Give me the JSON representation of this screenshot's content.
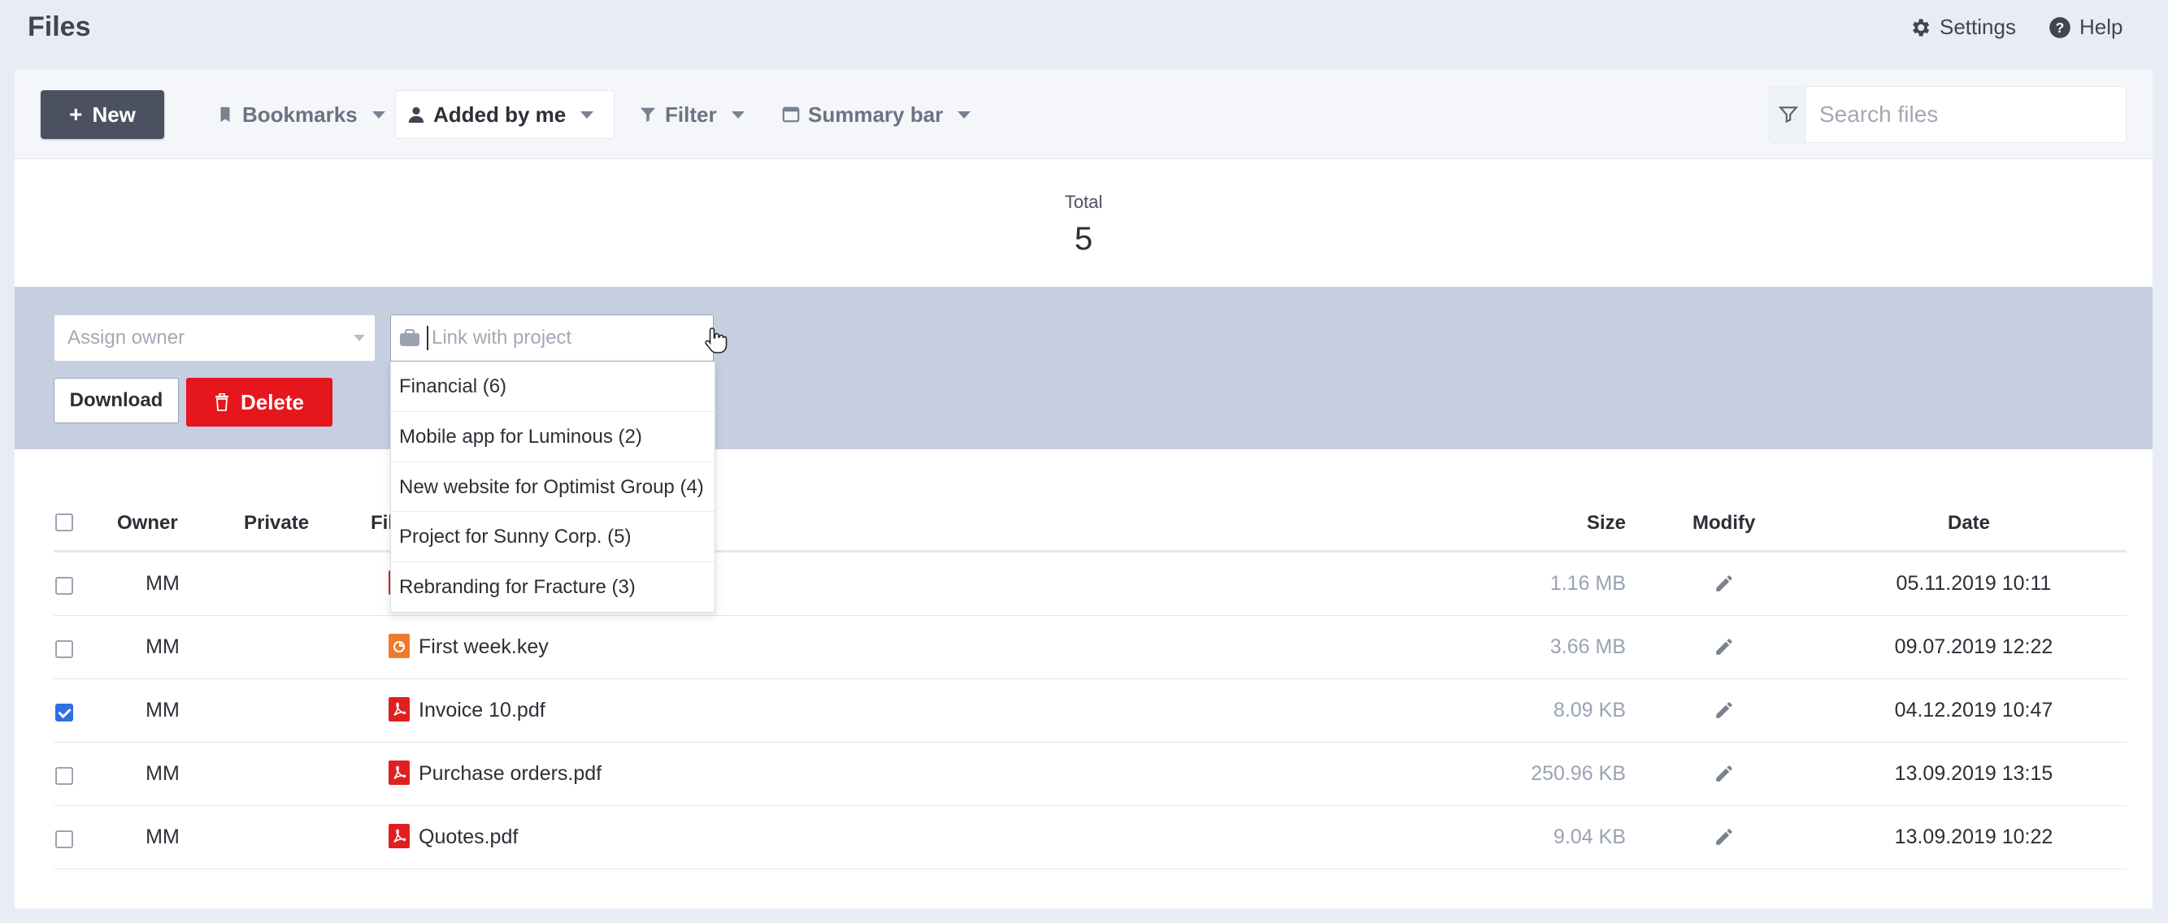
{
  "app": {
    "title": "Files"
  },
  "topbar": {
    "settings_label": "Settings",
    "help_label": "Help"
  },
  "toolbar": {
    "new_label": "New",
    "bookmarks_label": "Bookmarks",
    "added_by_me_label": "Added by me",
    "filter_label": "Filter",
    "summary_bar_label": "Summary bar"
  },
  "search": {
    "placeholder": "Search files"
  },
  "summary": {
    "label": "Total",
    "value": "5"
  },
  "bulk": {
    "assign_owner_placeholder": "Assign owner",
    "link_project_placeholder": "Link with project",
    "download_label": "Download",
    "delete_label": "Delete"
  },
  "project_options": [
    "Financial (6)",
    "Mobile app for Luminous (2)",
    "New website for Optimist Group (4)",
    "Project for Sunny Corp. (5)",
    "Rebranding for Fracture (3)"
  ],
  "table": {
    "headers": {
      "owner": "Owner",
      "private": "Private",
      "file": "File",
      "size": "Size",
      "modify": "Modify",
      "date": "Date"
    },
    "rows": [
      {
        "checked": false,
        "owner": "MM",
        "file": "",
        "file_type": "pdf",
        "size": "1.16 MB",
        "date": "05.11.2019 10:11"
      },
      {
        "checked": false,
        "owner": "MM",
        "file": "First week.key",
        "file_type": "key",
        "size": "3.66 MB",
        "date": "09.07.2019 12:22"
      },
      {
        "checked": true,
        "owner": "MM",
        "file": "Invoice 10.pdf",
        "file_type": "pdf",
        "size": "8.09 KB",
        "date": "04.12.2019 10:47"
      },
      {
        "checked": false,
        "owner": "MM",
        "file": "Purchase orders.pdf",
        "file_type": "pdf",
        "size": "250.96 KB",
        "date": "13.09.2019 13:15"
      },
      {
        "checked": false,
        "owner": "MM",
        "file": "Quotes.pdf",
        "file_type": "pdf",
        "size": "9.04 KB",
        "date": "13.09.2019 10:22"
      }
    ]
  },
  "colors": {
    "primary_dark": "#4b5160",
    "danger": "#e5161c",
    "band": "#c5cfe0",
    "checkbox_checked": "#2f6fe4",
    "pdf_red": "#e02020",
    "key_orange": "#f07a2c"
  }
}
